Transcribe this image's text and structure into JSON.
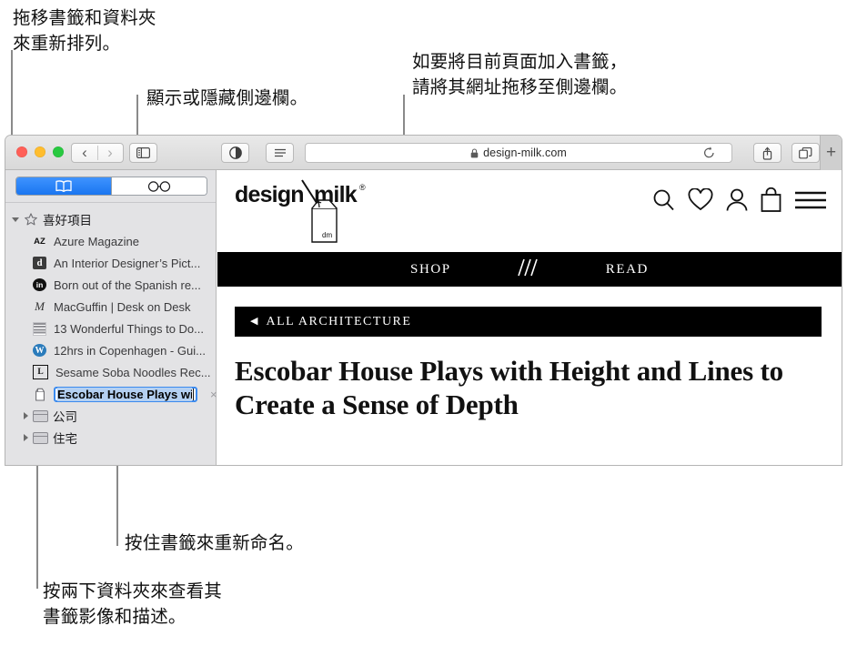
{
  "callouts": {
    "drag_reorder": "拖移書籤和資料夾\n來重新排列。",
    "show_hide_sidebar": "顯示或隱藏側邊欄。",
    "add_bookmark": "如要將目前頁面加入書籤，\n請將其網址拖移至側邊欄。",
    "press_to_rename": "按住書籤來重新命名。",
    "double_click_folder": "按兩下資料夾來查看其\n書籤影像和描述。"
  },
  "browser": {
    "window_controls": {
      "close": "close-button",
      "minimize": "minimize-button",
      "zoom": "zoom-button"
    },
    "nav": {
      "back": "‹",
      "forward": "›"
    },
    "buttons": {
      "sidebar": "sidebar-toggle",
      "reader": "reader-view",
      "sharing": "text-size",
      "share": "share",
      "tabs": "show-tabs",
      "new_tab": "+"
    },
    "address": {
      "lock_icon": "lock-icon",
      "url": "design-milk.com",
      "reload_icon": "reload-icon"
    }
  },
  "sidebar": {
    "segments": [
      {
        "id": "bookmarks",
        "icon": "book-icon",
        "active": true
      },
      {
        "id": "reading-list",
        "icon": "glasses-icon",
        "active": false
      }
    ],
    "group": {
      "title": "喜好項目",
      "icon": "star-icon"
    },
    "bookmarks": [
      {
        "favicon": "AZ",
        "label": "Azure Magazine"
      },
      {
        "favicon": "d",
        "label": "An Interior Designer’s Pict..."
      },
      {
        "favicon": "in",
        "label": "Born out of the Spanish re..."
      },
      {
        "favicon": "M",
        "label": "MacGuffin | Desk on Desk"
      },
      {
        "favicon": "grid",
        "label": "13 Wonderful Things to Do..."
      },
      {
        "favicon": "W",
        "label": "12hrs in Copenhagen - Gui..."
      },
      {
        "favicon": "L",
        "label": "Sesame Soba Noodles Rec..."
      }
    ],
    "editing_bookmark": {
      "favicon": "milk-carton-icon",
      "value": "Escobar House Plays with ",
      "close_label": "×"
    },
    "folders": [
      {
        "label": "公司"
      },
      {
        "label": "住宅"
      }
    ]
  },
  "page": {
    "logo": {
      "text_left": "design",
      "separator": "\\",
      "text_right": "milk",
      "registered": "®",
      "carton_label": "dm"
    },
    "header_icons": [
      "search-icon",
      "heart-icon",
      "account-icon",
      "shopping-bag-icon",
      "hamburger-menu-icon"
    ],
    "nav_links": [
      "SHOP",
      "READ"
    ],
    "nav_divider_icon": "triple-slash-icon",
    "breadcrumb": {
      "arrow": "◀",
      "label": "ALL ARCHITECTURE"
    },
    "headline": "Escobar House Plays with Height and Lines to Create a Sense of Depth"
  }
}
